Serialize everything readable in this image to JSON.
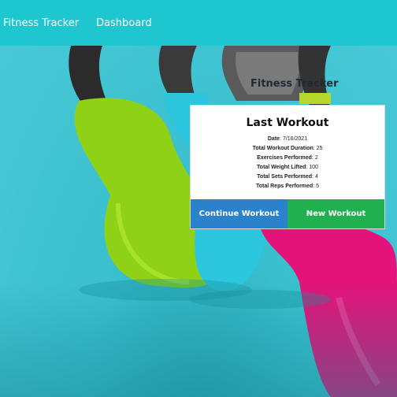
{
  "nav": {
    "brand": "Fitness Tracker",
    "dashboard": "Dashboard"
  },
  "page": {
    "title": "Fitness Tracker"
  },
  "card": {
    "title": "Last Workout",
    "stats": [
      {
        "label": "Date",
        "value": "7/16/2021"
      },
      {
        "label": "Total Workout Duration",
        "value": "25"
      },
      {
        "label": "Exercises Performed",
        "value": "2"
      },
      {
        "label": "Total Weight Lifted",
        "value": "100"
      },
      {
        "label": "Total Sets Performed",
        "value": "4"
      },
      {
        "label": "Total Reps Performed",
        "value": "5"
      }
    ],
    "continue_label": "Continue Workout",
    "new_label": "New Workout"
  },
  "colors": {
    "nav": "#1ec6cf",
    "continue": "#2b82cc",
    "new": "#21b04f",
    "kettlebell_green": "#8fd117",
    "kettlebell_pink": "#e4137a",
    "kettlebell_blue": "#2cc6de"
  }
}
